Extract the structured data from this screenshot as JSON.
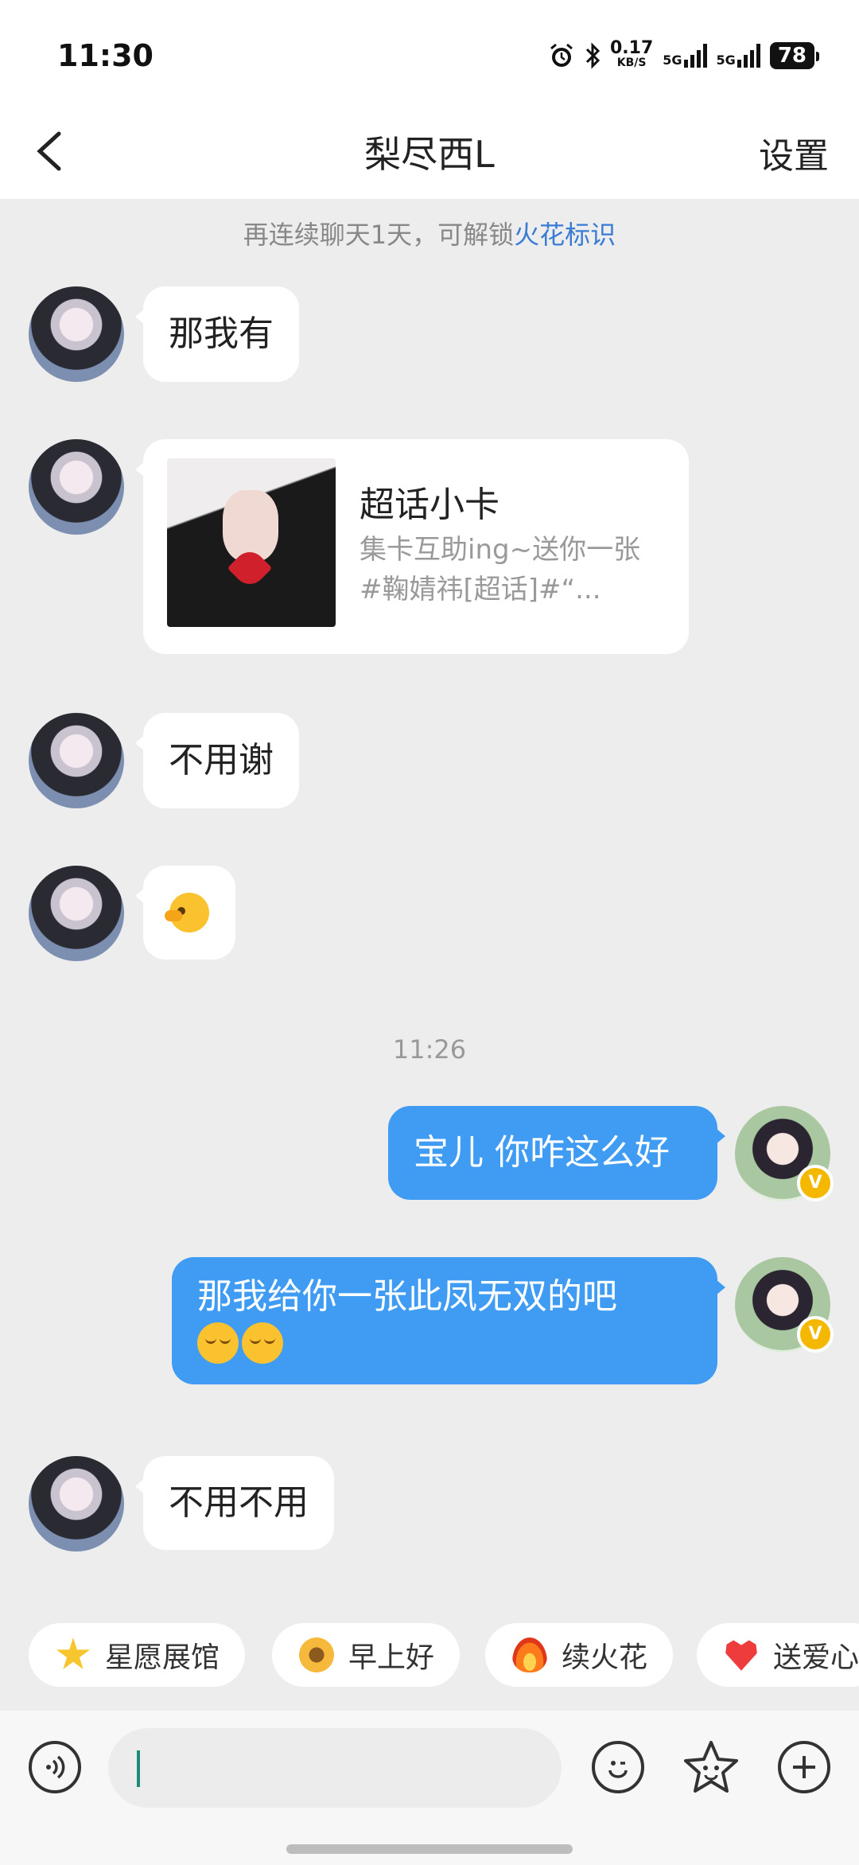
{
  "status_bar": {
    "time": "11:30",
    "net_speed": "0.17",
    "net_unit": "KB/S",
    "sig1": "5G",
    "sig2": "5G",
    "battery": "78"
  },
  "header": {
    "title": "梨尽西L",
    "settings_label": "设置"
  },
  "notice": {
    "text": "再连续聊天1天，可解锁",
    "highlight": "火花标识",
    "highlight_color": "#3a7bd5"
  },
  "messages": [
    {
      "side": "left",
      "text": "那我有"
    },
    {
      "side": "left",
      "type": "card",
      "title": "超话小卡",
      "desc": "集卡互助ing~送你一张#鞠婧祎[超话]#“..."
    },
    {
      "side": "left",
      "text": "不用谢"
    },
    {
      "side": "left",
      "type": "emoji",
      "icon": "wink-emoji-icon"
    },
    {
      "side": "right",
      "text": "宝儿 你咋这么好"
    },
    {
      "side": "right",
      "text": "那我给你一张此凤无双的吧"
    },
    {
      "side": "left",
      "text": "不用不用"
    }
  ],
  "timestamp": "11:26",
  "quick_replies": [
    {
      "label": "星愿展馆",
      "icon": "star-icon"
    },
    {
      "label": "早上好",
      "icon": "sunflower-icon"
    },
    {
      "label": "续火花",
      "icon": "fire-icon"
    },
    {
      "label": "送爱心",
      "icon": "heart-icon"
    }
  ],
  "input": {
    "placeholder": ""
  },
  "colors": {
    "bubble_right": "#3f9cf2",
    "bubble_left": "#ffffff",
    "background": "#ededed"
  }
}
